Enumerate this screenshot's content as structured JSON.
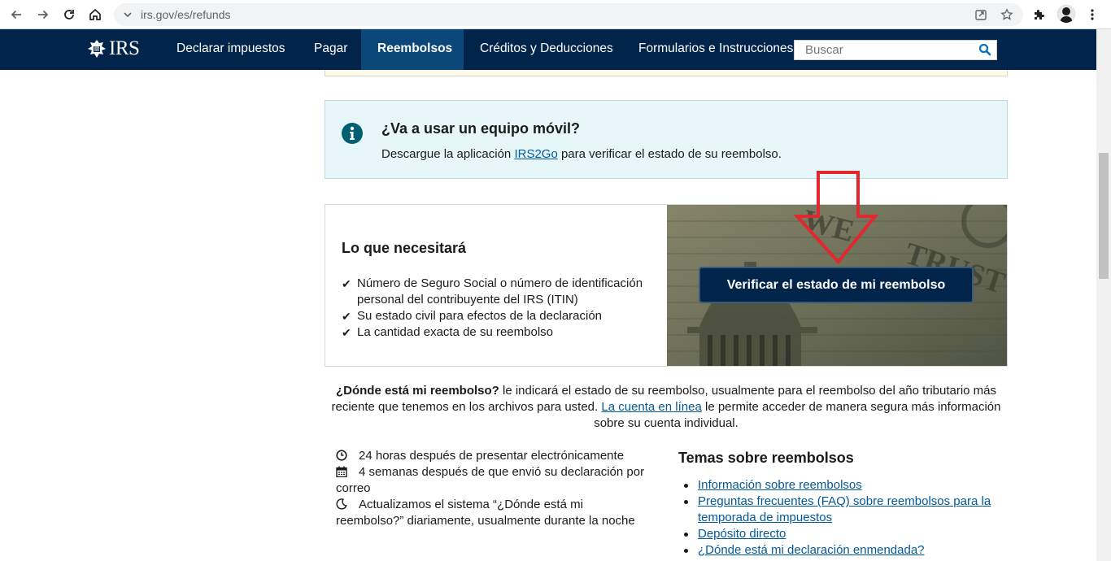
{
  "browser": {
    "url": "irs.gov/es/refunds"
  },
  "nav": {
    "logo": "IRS",
    "items": [
      {
        "label": "Declarar impuestos"
      },
      {
        "label": "Pagar"
      },
      {
        "label": "Reembolsos",
        "active": true
      },
      {
        "label": "Créditos y Deducciones"
      },
      {
        "label": "Formularios e Instrucciones"
      }
    ],
    "search_placeholder": "Buscar"
  },
  "info": {
    "title": "¿Va a usar un equipo móvil?",
    "text_before": "Descargue la aplicación ",
    "link": "IRS2Go",
    "text_after": " para verificar el estado de su reembolso."
  },
  "need": {
    "title": "Lo que necesitará",
    "items": [
      "Número de Seguro Social o número de identificación personal del contribuyente del IRS (ITIN)",
      "Su estado civil para efectos de la declaración",
      "La cantidad exacta de su reembolso"
    ]
  },
  "verify_button": "Verificar el estado de mi reembolso",
  "wmr": {
    "bold": "¿Dónde está mi reembolso?",
    "text1": " le indicará el estado de su reembolso, usualmente para el reembolso del año tributario más reciente que tenemos en los archivos para usted. ",
    "link": "La cuenta en línea",
    "text2": " le permite acceder de manera segura más información sobre su cuenta individual."
  },
  "timeline": [
    {
      "icon": "clock-icon",
      "text": "24 horas después de presentar electrónicamente"
    },
    {
      "icon": "calendar-icon",
      "text": "4 semanas después de que envió su declaración por correo"
    },
    {
      "icon": "moon-icon",
      "text": "Actualizamos el sistema “¿Dónde está mi reembolso?” diariamente, usualmente durante la noche"
    }
  ],
  "topics": {
    "title": "Temas sobre reembolsos",
    "links": [
      "Información sobre reembolsos",
      "Preguntas frecuentes (FAQ) sobre reembolsos para la temporada de impuestos",
      "Depósito directo",
      "¿Dónde está mi declaración enmendada?"
    ]
  },
  "colors": {
    "navy": "#00244a",
    "active_tab": "#0b4778",
    "link": "#00599c",
    "info_bg": "#e7f6f8",
    "annotation_arrow": "#e0282e"
  }
}
